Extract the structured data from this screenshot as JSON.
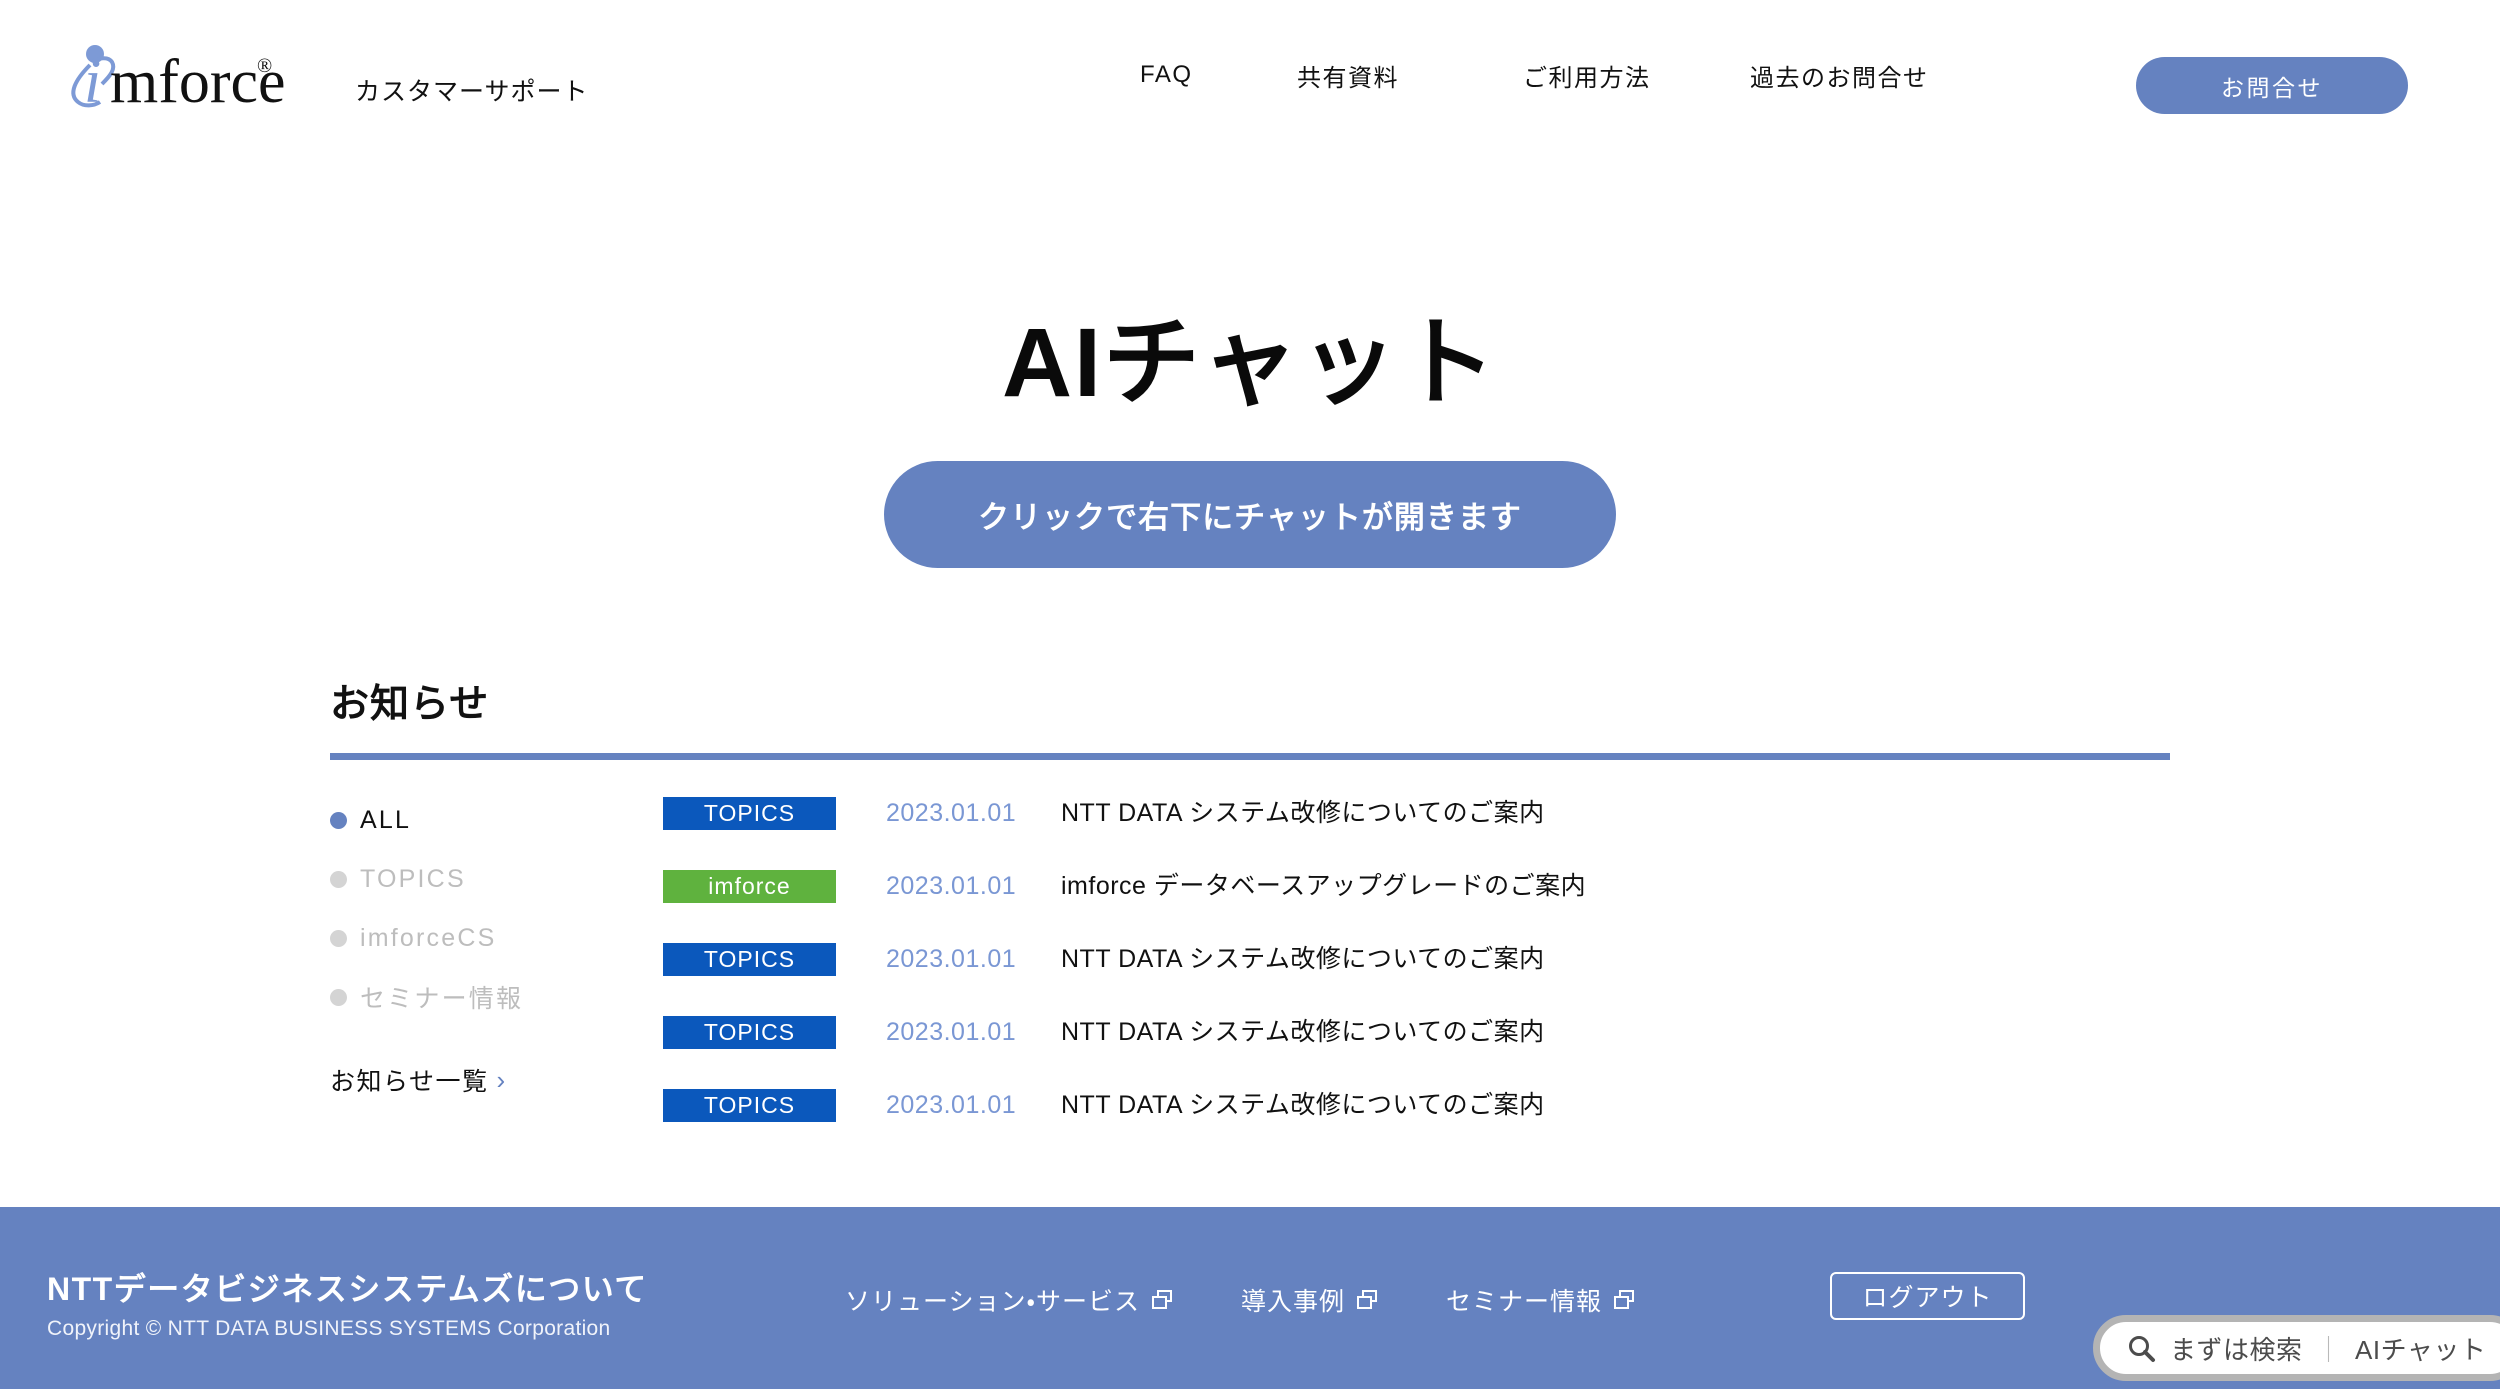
{
  "header": {
    "logo_text": "imforce",
    "logo_reg_mark": "®",
    "subtitle": "カスタマーサポート",
    "nav": [
      {
        "label": "FAQ"
      },
      {
        "label": "共有資料"
      },
      {
        "label": "ご利用方法"
      },
      {
        "label": "過去のお問合せ"
      }
    ],
    "contact_button": "お問合せ"
  },
  "hero": {
    "title": "AIチャット",
    "cta_label": "クリックで右下にチャットが開きます"
  },
  "news": {
    "heading": "お知らせ",
    "filters": [
      {
        "label": "ALL",
        "active": true
      },
      {
        "label": "TOPICS",
        "active": false
      },
      {
        "label": "imforceCS",
        "active": false
      },
      {
        "label": "セミナー情報",
        "active": false
      }
    ],
    "all_link": "お知らせ一覧",
    "all_link_chevron": "›",
    "items": [
      {
        "badge": "TOPICS",
        "badge_type": "topics",
        "date": "2023.01.01",
        "title": "NTT DATA システム改修についてのご案内"
      },
      {
        "badge": "imforce",
        "badge_type": "imforce",
        "date": "2023.01.01",
        "title": "imforce データベースアップグレードのご案内"
      },
      {
        "badge": "TOPICS",
        "badge_type": "topics",
        "date": "2023.01.01",
        "title": "NTT DATA システム改修についてのご案内"
      },
      {
        "badge": "TOPICS",
        "badge_type": "topics",
        "date": "2023.01.01",
        "title": "NTT DATA システム改修についてのご案内"
      },
      {
        "badge": "TOPICS",
        "badge_type": "topics",
        "date": "2023.01.01",
        "title": "NTT DATA システム改修についてのご案内"
      }
    ]
  },
  "footer": {
    "brand": "NTTデータビジネスシステムズについて",
    "copyright": "Copyright © NTT DATA BUSINESS SYSTEMS Corporation",
    "links": [
      {
        "label": "ソリューション・サービス",
        "icon": "external-link-icon"
      },
      {
        "label": "導入事例",
        "icon": "external-link-icon"
      },
      {
        "label": "セミナー情報",
        "icon": "external-link-icon"
      }
    ],
    "logout_label": "ログアウト"
  },
  "search_fab": {
    "icon": "search-icon",
    "label_primary": "まずは検索",
    "separator": "｜",
    "label_secondary": "AIチャット"
  },
  "colors": {
    "accent_blue": "#6582c0",
    "badge_topics": "#0b58bc",
    "badge_imforce": "#5fb23e",
    "date_blue": "#7a97d4",
    "muted_gray": "#bdbdbd",
    "footer_bg": "#6582c0"
  }
}
